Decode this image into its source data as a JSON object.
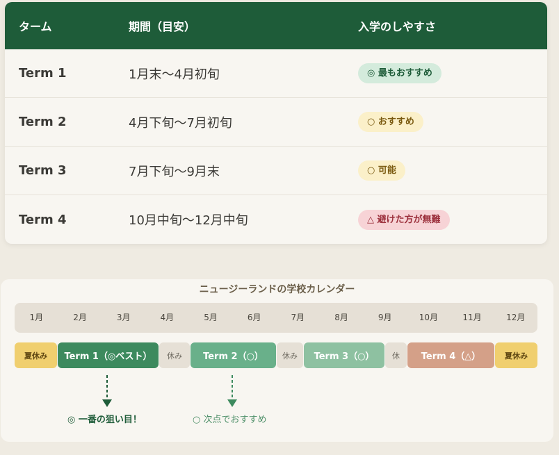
{
  "table": {
    "headers": [
      "ターム",
      "期間（目安）",
      "入学のしやすさ"
    ],
    "rows": [
      {
        "term": "Term 1",
        "period": "1月末〜4月初旬",
        "badge": "◎ 最もおすすめ",
        "badge_type": "best"
      },
      {
        "term": "Term 2",
        "period": "4月下旬〜7月初旬",
        "badge": "○ おすすめ",
        "badge_type": "rec"
      },
      {
        "term": "Term 3",
        "period": "7月下旬〜9月末",
        "badge": "○ 可能",
        "badge_type": "ok"
      },
      {
        "term": "Term 4",
        "period": "10月中旬〜12月中旬",
        "badge": "△ 避けた方が無難",
        "badge_type": "avoid"
      }
    ]
  },
  "calendar": {
    "title": "ニュージーランドの学校カレンダー",
    "months": [
      "1月",
      "2月",
      "3月",
      "4月",
      "5月",
      "6月",
      "7月",
      "8月",
      "9月",
      "10月",
      "11月",
      "12月"
    ],
    "segments": {
      "summer_start": "夏休み",
      "term1": "Term 1（◎ベスト）",
      "break1": "休み",
      "term2": "Term 2（○）",
      "break2": "休み",
      "term3": "Term 3（○）",
      "break3": "休",
      "term4": "Term 4（△）",
      "summer_end": "夏休み"
    },
    "notes": {
      "best": "◎ 一番の狙い目！",
      "recommended": "○ 次点でおすすめ"
    }
  },
  "colors": {
    "header_green": "#1e5c39",
    "term1": "#3d8a5e",
    "term2": "#69b08a",
    "term3": "#8ec1a1",
    "term4": "#d4a088",
    "holiday": "#f0cf6f",
    "badge_best_bg": "#d4ebdc",
    "badge_rec_bg": "#fbf0c9",
    "badge_avoid_bg": "#f7d3d6"
  }
}
